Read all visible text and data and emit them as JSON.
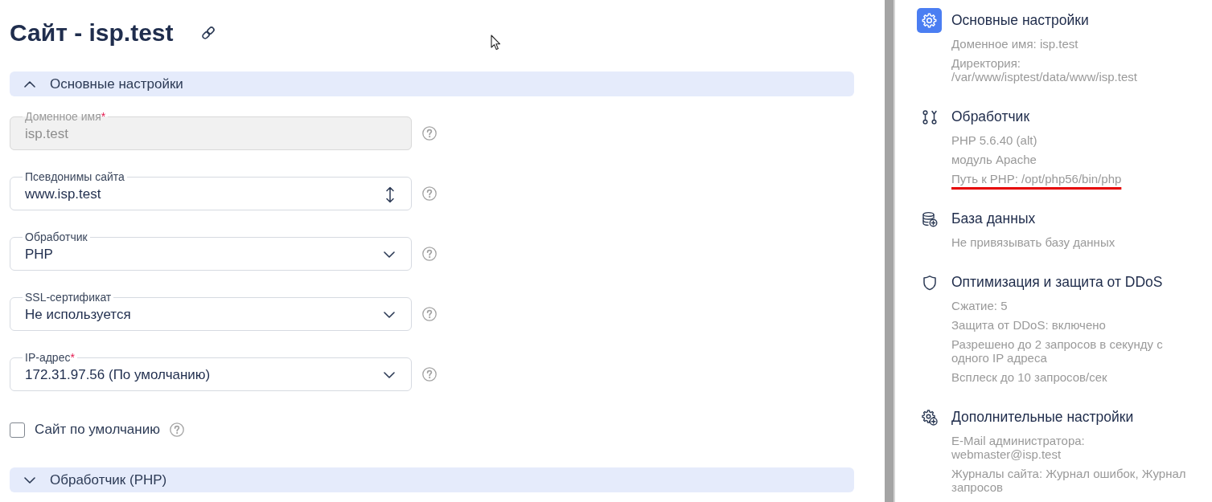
{
  "page": {
    "title": "Сайт - isp.test"
  },
  "sections": [
    {
      "title": "Основные настройки",
      "expanded": true,
      "fields": [
        {
          "kind": "input",
          "label": "Доменное имя",
          "required_mark": "*",
          "value": "isp.test",
          "disabled": true
        },
        {
          "kind": "expandable",
          "label": "Псевдонимы сайта",
          "value": "www.isp.test",
          "disabled": false
        },
        {
          "kind": "select",
          "label": "Обработчик",
          "value": "PHP",
          "disabled": false
        },
        {
          "kind": "select",
          "label": "SSL-сертификат",
          "value": "Не используется",
          "disabled": false
        },
        {
          "kind": "select",
          "label": "IP-адрес",
          "required_mark": "*",
          "value": "172.31.97.56 (По умолчанию)",
          "disabled": false
        }
      ],
      "checkbox": {
        "label": "Сайт по умолчанию",
        "checked": false
      }
    },
    {
      "title": "Обработчик (PHP)",
      "expanded": false
    }
  ],
  "summary": [
    {
      "title": "Основные настройки",
      "selected": true,
      "details": [
        {
          "text": "Доменное имя: isp.test",
          "underlined": false
        },
        {
          "text": "Директория: /var/www/isptest/data/www/isp.test",
          "underlined": false
        }
      ]
    },
    {
      "title": "Обработчик",
      "selected": false,
      "details": [
        {
          "text": "PHP 5.6.40 (alt)",
          "underlined": false
        },
        {
          "text": "модуль Apache",
          "underlined": false
        },
        {
          "text": "Путь к PHP: /opt/php56/bin/php",
          "underlined": true
        }
      ]
    },
    {
      "title": "База данных",
      "selected": false,
      "details": [
        {
          "text": "Не привязывать базу данных",
          "underlined": false
        }
      ]
    },
    {
      "title": "Оптимизация и защита от DDoS",
      "selected": false,
      "details": [
        {
          "text": "Сжатие: 5",
          "underlined": false
        },
        {
          "text": "Защита от DDoS: включено",
          "underlined": false
        },
        {
          "text": "Разрешено до 2 запросов в секунду с одного IP адреса",
          "underlined": false
        },
        {
          "text": "Всплеск до 10 запросов/сек",
          "underlined": false
        }
      ]
    },
    {
      "title": "Дополнительные настройки",
      "selected": false,
      "details": [
        {
          "text": "E-Mail администратора: webmaster@isp.test",
          "underlined": false
        },
        {
          "text": "Журналы сайта: Журнал ошибок, Журнал запросов",
          "underlined": false
        }
      ]
    }
  ]
}
